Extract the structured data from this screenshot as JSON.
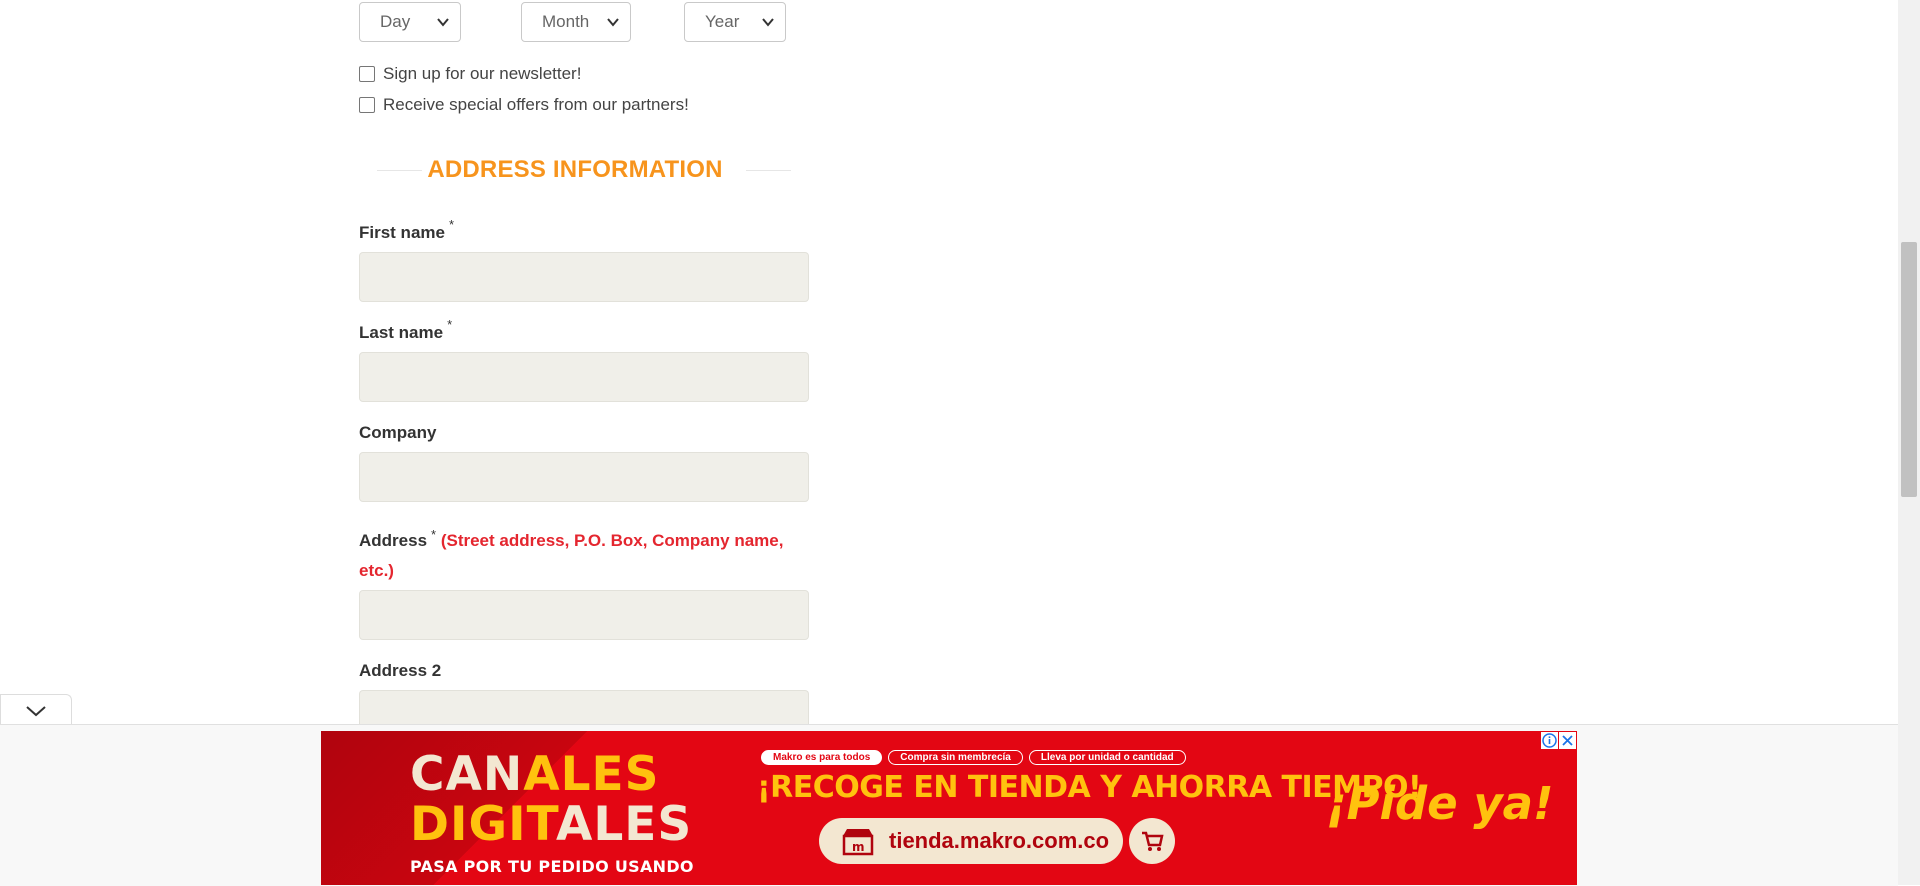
{
  "birth_date": {
    "day_value": "Day",
    "month_value": "Month",
    "year_value": "Year"
  },
  "options": {
    "newsletter_label": "Sign up for our newsletter!",
    "partners_label": "Receive special offers from our partners!"
  },
  "address_section": {
    "title": "ADDRESS INFORMATION",
    "required_marker": "*",
    "first_name_label": "First name",
    "last_name_label": "Last name",
    "company_label": "Company",
    "address_label": "Address",
    "address_hint": "(Street address, P.O. Box, Company name, etc.)",
    "address2_label": "Address 2"
  },
  "ad": {
    "brand_line1_a": "CAN",
    "brand_line1_b": "ALES",
    "brand_line2_a": "DIGIT",
    "brand_line2_b": "ALES",
    "brand_sub": "PASA POR TU PEDIDO USANDO",
    "pills": [
      "Makro es para todos",
      "Compra sin membrecía",
      "Lleva por unidad o cantidad"
    ],
    "headline": "¡RECOGE EN TIENDA Y AHORRA TIEMPO!",
    "url": "tienda.makro.com.co",
    "cta": "¡Pide ya!",
    "colors": {
      "background": "#e30613",
      "accent": "#ffc20e",
      "cream": "#f3e7d1"
    }
  },
  "colors": {
    "section_title": "#f7941d",
    "hint": "#e4262f",
    "input_bg": "#f0efe9"
  }
}
